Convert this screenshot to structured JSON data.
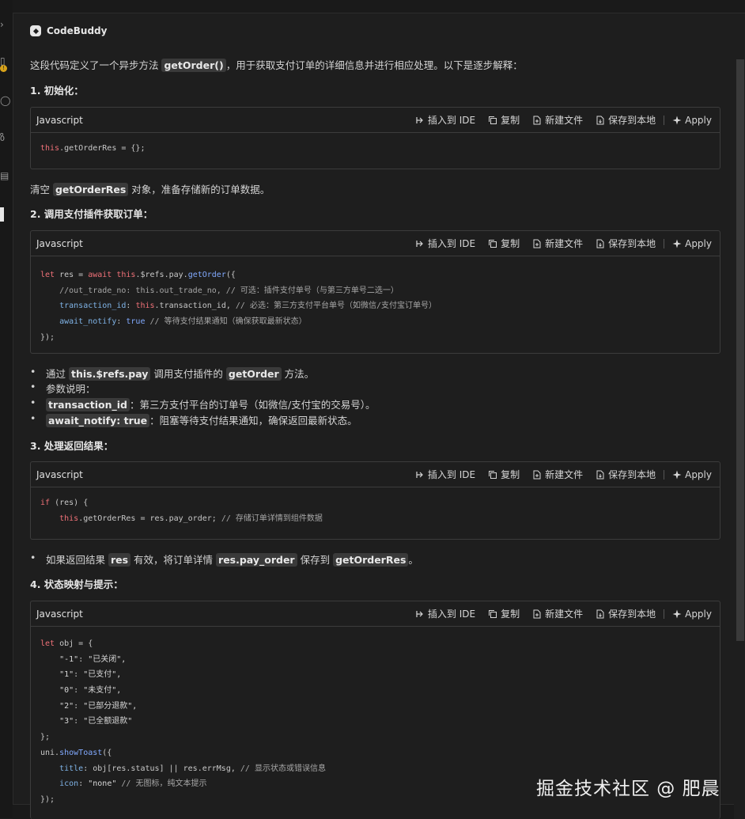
{
  "brand": {
    "name": "CodeBuddy"
  },
  "intro": {
    "pre": "这段代码定义了一个异步方法 ",
    "code": "getOrder()",
    "post": "，用于获取支付订单的详细信息并进行相应处理。以下是逐步解释："
  },
  "toolbar": {
    "insert": "插入到 IDE",
    "copy": "复制",
    "new_file": "新建文件",
    "save": "保存到本地",
    "apply": "Apply"
  },
  "sections": [
    {
      "heading": "1. 初始化："
    },
    {
      "heading": "2. 调用支付插件获取订单："
    },
    {
      "heading": "3. 处理返回结果："
    },
    {
      "heading": "4. 状态映射与提示："
    }
  ],
  "blocks": [
    {
      "lang": "Javascript"
    },
    {
      "lang": "Javascript"
    },
    {
      "lang": "Javascript"
    },
    {
      "lang": "Javascript"
    }
  ],
  "explain1": {
    "pre": "清空 ",
    "code": "getOrderRes",
    "post": " 对象，准备存储新的订单数据。"
  },
  "bullets2": [
    {
      "pre": "通过 ",
      "code1": "this.$refs.pay",
      "mid": " 调用支付插件的 ",
      "code2": "getOrder",
      "post": " 方法。"
    },
    {
      "text": "参数说明："
    },
    {
      "code": "transaction_id",
      "post": "：第三方支付平台的订单号（如微信/支付宝的交易号）。"
    },
    {
      "code": "await_notify: true",
      "post": "：阻塞等待支付结果通知，确保返回最新状态。"
    }
  ],
  "bullet3": {
    "pre": "如果返回结果 ",
    "code1": "res",
    "mid1": " 有效，将订单详情 ",
    "code2": "res.pay_order",
    "mid2": " 保存到 ",
    "code3": "getOrderRes",
    "post": "。"
  },
  "code1": {
    "kw": "this",
    "rest": ".getOrderRes = {};"
  },
  "code2": {
    "l1": {
      "kw1": "let",
      "a": " res = ",
      "kw2": "await",
      "b": " ",
      "kw3": "this",
      "c": ".$refs.pay.",
      "fn": "getOrder",
      "d": "({"
    },
    "l2": {
      "cm": "//out_trade_no: this.out_trade_no, // 可选：插件支付单号（与第三方单号二选一）"
    },
    "l3": {
      "pr": "transaction_id",
      "a": ": ",
      "kw": "this",
      "b": ".transaction_id, ",
      "cm": "// 必选：第三方支付平台单号（如微信/支付宝订单号）"
    },
    "l4": {
      "pr": "await_notify",
      "a": ": ",
      "kw": "true",
      "b": " ",
      "cm": "// 等待支付结果通知（确保获取最新状态）"
    },
    "l5": {
      "a": "});"
    }
  },
  "code3": {
    "l1": {
      "kw": "if",
      "a": " (res) {"
    },
    "l2": {
      "kw": "this",
      "a": ".getOrderRes = res.pay_order; ",
      "cm": "// 存储订单详情到组件数据"
    }
  },
  "code4": {
    "l1": {
      "kw": "let",
      "a": " obj = {"
    },
    "l2": {
      "k": "\"-1\"",
      "v": "\"已关闭\","
    },
    "l3": {
      "k": "\"1\"",
      "v": "\"已支付\","
    },
    "l4": {
      "k": "\"0\"",
      "v": "\"未支付\","
    },
    "l5": {
      "k": "\"2\"",
      "v": "\"已部分退款\","
    },
    "l6": {
      "k": "\"3\"",
      "v": "\"已全额退款\""
    },
    "l7": {
      "a": "};"
    },
    "l8": {
      "a": "uni.",
      "fn": "showToast",
      "b": "({"
    },
    "l9": {
      "pr": "title",
      "a": ": obj[res.status] || res.errMsg, ",
      "cm": "// 显示状态或错误信息"
    },
    "l10": {
      "pr": "icon",
      "a": ": ",
      "v": "\"none\"",
      "cm": " // 无图标，纯文本提示"
    },
    "l11": {
      "a": "});"
    }
  },
  "watermark": "掘金技术社区 @ 肥晨"
}
